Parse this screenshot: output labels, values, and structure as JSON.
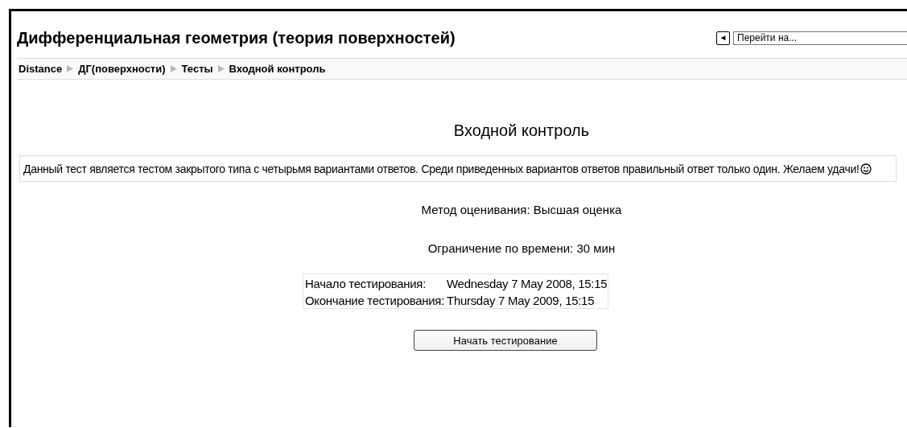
{
  "course_title": "Дифференциальная геометрия (теория поверхностей)",
  "jump": {
    "button": "◄",
    "placeholder": "Перейти на..."
  },
  "breadcrumb": [
    "Distance",
    "ДГ(поверхности)",
    "Тесты",
    "Входной контроль"
  ],
  "heading": "Входной контроль",
  "intro": "Данный тест является тестом закрытого типа с четырьмя вариантами ответов. Среди приведенных вариантов ответов правильный ответ только один. Желаем удачи!",
  "grading": "Метод оценивания: Высшая оценка",
  "time_limit": "Ограничение по времени: 30 мин",
  "dates": [
    {
      "label": "Начало тестирования:",
      "value": "Wednesday 7 May 2008, 15:15"
    },
    {
      "label": "Окончание тестирования:",
      "value": "Thursday 7 May 2009, 15:15"
    }
  ],
  "start_button": "Начать тестирование"
}
